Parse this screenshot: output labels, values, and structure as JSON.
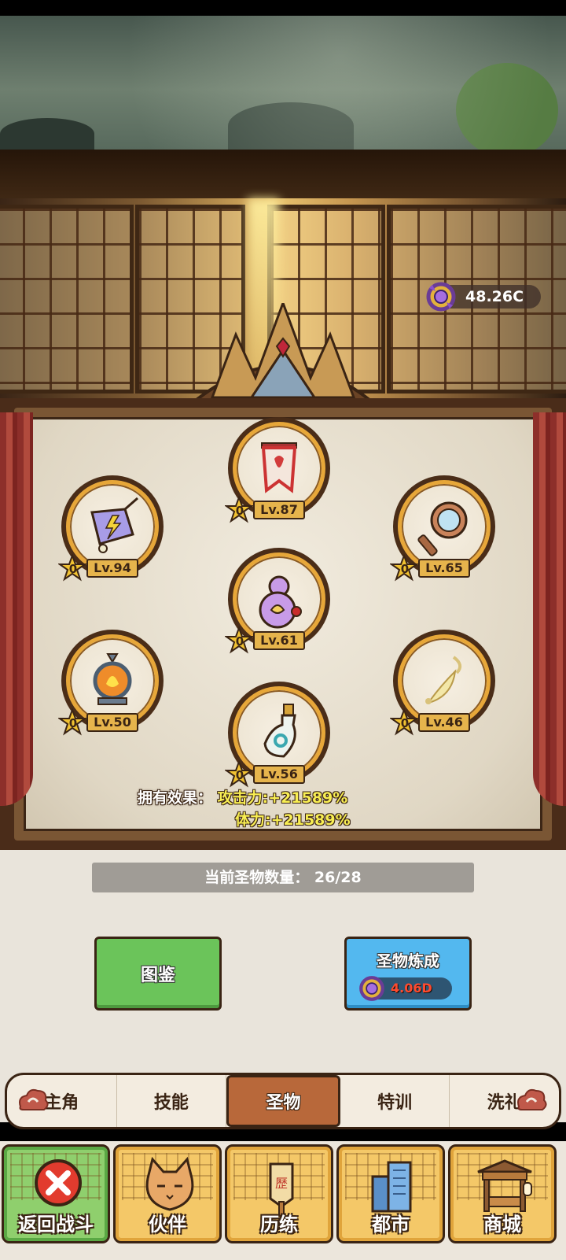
{
  "currency": {
    "amount": "48.26C",
    "icon": "ring-gem-icon"
  },
  "relics": [
    {
      "id": "banner",
      "level": "Lv.87",
      "stars": "0",
      "icon": "red-banner-icon"
    },
    {
      "id": "bell",
      "level": "Lv.94",
      "stars": "0",
      "icon": "lightning-bell-icon"
    },
    {
      "id": "mirror",
      "level": "Lv.65",
      "stars": "0",
      "icon": "hand-mirror-icon"
    },
    {
      "id": "gourd",
      "level": "Lv.61",
      "stars": "0",
      "icon": "purple-gourd-icon"
    },
    {
      "id": "lantern",
      "level": "Lv.50",
      "stars": "0",
      "icon": "fire-lantern-icon"
    },
    {
      "id": "whisk",
      "level": "Lv.46",
      "stars": "0",
      "icon": "golden-whisk-icon"
    },
    {
      "id": "vase",
      "level": "Lv.56",
      "stars": "0",
      "icon": "jade-vase-icon"
    }
  ],
  "effects": {
    "label": "拥有效果：",
    "attack": "攻击力:+21589%",
    "stamina": "体力:+21589%"
  },
  "relic_count": "当前圣物数量：  26/28",
  "buttons": {
    "codex": "图鉴",
    "refine": "圣物炼成",
    "refine_cost": "4.06D"
  },
  "tabs": [
    {
      "label": "主角",
      "active": false
    },
    {
      "label": "技能",
      "active": false
    },
    {
      "label": "圣物",
      "active": true
    },
    {
      "label": "特训",
      "active": false
    },
    {
      "label": "洗礼",
      "active": false
    }
  ],
  "nav": [
    {
      "label": "返回战斗",
      "icon": "red-x-icon"
    },
    {
      "label": "伙伴",
      "icon": "cat-face-icon"
    },
    {
      "label": "历练",
      "icon": "wooden-sign-icon"
    },
    {
      "label": "都市",
      "icon": "skyscraper-icon"
    },
    {
      "label": "商城",
      "icon": "market-stall-icon"
    }
  ],
  "colors": {
    "accent_gold": "#e7a739",
    "button_green": "#6bc45a",
    "button_blue": "#53b8ef",
    "tab_active": "#b8683a",
    "effect_yellow": "#f8ee53",
    "cost_red": "#ff4a2e"
  }
}
